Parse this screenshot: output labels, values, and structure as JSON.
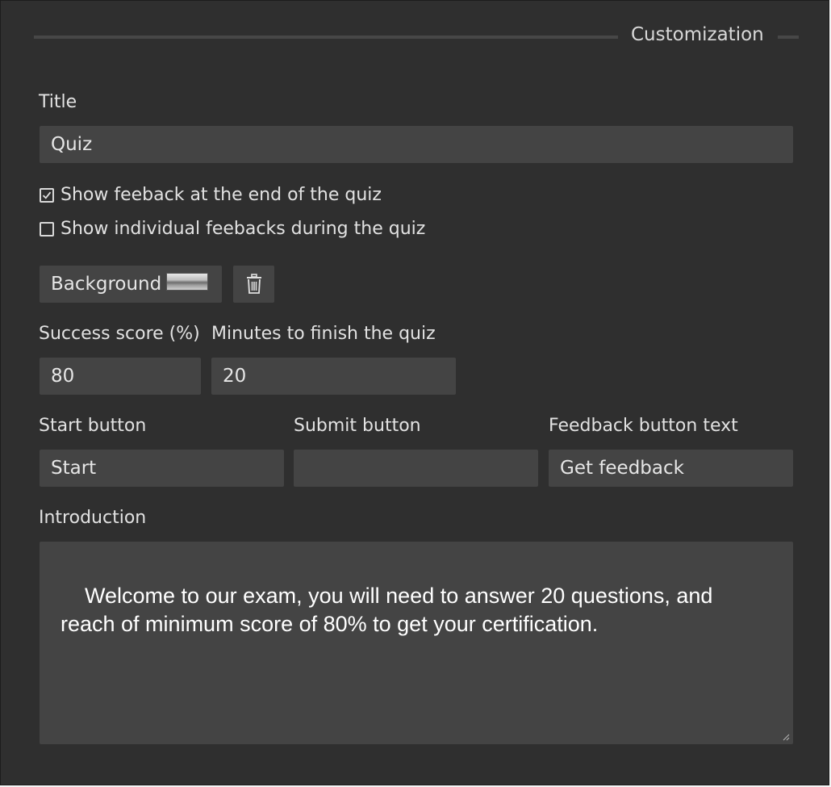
{
  "section": {
    "title": "Customization"
  },
  "title_field": {
    "label": "Title",
    "value": "Quiz"
  },
  "options": {
    "show_feedback_end": {
      "label": "Show feeback at the end of the quiz",
      "checked": true
    },
    "show_individual_feedbacks": {
      "label": "Show individual feebacks during the quiz",
      "checked": false
    }
  },
  "background": {
    "button_label": "Background",
    "delete_icon": "trash-icon"
  },
  "success_score": {
    "label": "Success score (%)",
    "value": "80"
  },
  "minutes": {
    "label": "Minutes to finish the quiz",
    "value": "20"
  },
  "start_button": {
    "label": "Start button",
    "value": "Start"
  },
  "submit_button": {
    "label": "Submit button",
    "value": ""
  },
  "feedback_button": {
    "label": "Feedback button text",
    "value": "Get feedback"
  },
  "introduction": {
    "label": "Introduction",
    "value": "Welcome to our exam, you will need to answer 20 questions, and reach of minimum score of 80% to get your certification."
  },
  "colors": {
    "panel_bg": "#2f2f2f",
    "field_bg": "#444444",
    "text": "#e4e4e4",
    "divider": "#474747"
  }
}
